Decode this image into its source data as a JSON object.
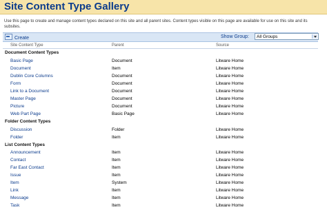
{
  "page": {
    "title": "Site Content Type Gallery",
    "description": "Use this page to create and manage content types declared on this site and all parent sites. Content types visible on this page are available for use on this site and its subsites."
  },
  "toolbar": {
    "create_label": "Create",
    "show_group_label": "Show Group:",
    "show_group_value": "All Groups"
  },
  "columns": [
    "Site Content Type",
    "Parent",
    "Source"
  ],
  "groups": [
    {
      "name": "Document Content Types",
      "items": [
        {
          "name": "Basic Page",
          "parent": "Document",
          "source": "Litware Home"
        },
        {
          "name": "Document",
          "parent": "Item",
          "source": "Litware Home"
        },
        {
          "name": "Dublin Core Columns",
          "parent": "Document",
          "source": "Litware Home"
        },
        {
          "name": "Form",
          "parent": "Document",
          "source": "Litware Home"
        },
        {
          "name": "Link to a Document",
          "parent": "Document",
          "source": "Litware Home"
        },
        {
          "name": "Master Page",
          "parent": "Document",
          "source": "Litware Home"
        },
        {
          "name": "Picture",
          "parent": "Document",
          "source": "Litware Home"
        },
        {
          "name": "Web Part Page",
          "parent": "Basic Page",
          "source": "Litware Home"
        }
      ]
    },
    {
      "name": "Folder Content Types",
      "items": [
        {
          "name": "Discussion",
          "parent": "Folder",
          "source": "Litware Home"
        },
        {
          "name": "Folder",
          "parent": "Item",
          "source": "Litware Home"
        }
      ]
    },
    {
      "name": "List Content Types",
      "items": [
        {
          "name": "Announcement",
          "parent": "Item",
          "source": "Litware Home"
        },
        {
          "name": "Contact",
          "parent": "Item",
          "source": "Litware Home"
        },
        {
          "name": "Far East Contact",
          "parent": "Item",
          "source": "Litware Home"
        },
        {
          "name": "Issue",
          "parent": "Item",
          "source": "Litware Home"
        },
        {
          "name": "Item",
          "parent": "System",
          "source": "Litware Home"
        },
        {
          "name": "Link",
          "parent": "Item",
          "source": "Litware Home"
        },
        {
          "name": "Message",
          "parent": "Item",
          "source": "Litware Home"
        },
        {
          "name": "Task",
          "parent": "Item",
          "source": "Litware Home"
        }
      ]
    }
  ],
  "colors": {
    "title_bar": "#f7e4a9",
    "title_text": "#0b3b8c",
    "link": "#0b3b8c",
    "toolbar": "#d9e6f5"
  },
  "icons": {
    "create": "new-item-icon",
    "dropdown": "chevron-down-icon"
  }
}
